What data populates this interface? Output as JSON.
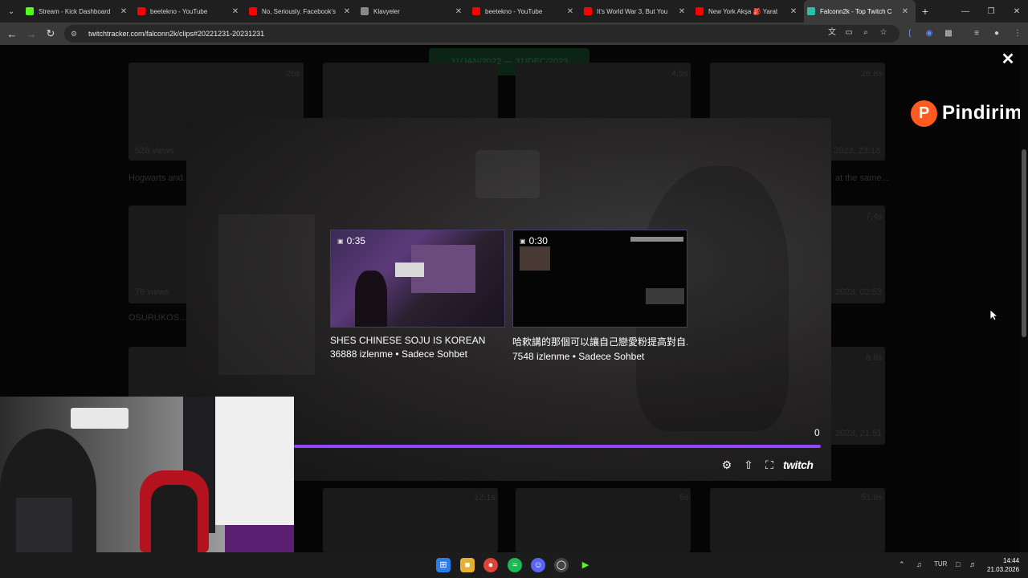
{
  "browser": {
    "tabs": [
      {
        "title": "Stream - Kick Dashboard",
        "icon": "kick-icon",
        "color": "#53fc18"
      },
      {
        "title": "beetekno - YouTube",
        "icon": "youtube-icon",
        "color": "#ff0000"
      },
      {
        "title": "No, Seriously. Facebook's",
        "icon": "youtube-icon",
        "color": "#ff0000"
      },
      {
        "title": "Klavyeler",
        "icon": "klavyeler-icon",
        "color": "#888888"
      },
      {
        "title": "beetekno - YouTube",
        "icon": "youtube-icon",
        "color": "#ff0000"
      },
      {
        "title": "It's World War 3, But You",
        "icon": "youtube-icon",
        "color": "#ff0000"
      },
      {
        "title": "New York Akşa 🎒 Yarat",
        "icon": "youtube-icon",
        "color": "#ff0000"
      },
      {
        "title": "Falconn2k - Top Twitch C",
        "icon": "twitchtracker-icon",
        "color": "#2fbfa8"
      }
    ],
    "active_tab_index": 7,
    "url": "twitchtracker.com/falconn2k/clips#20221231-20231231"
  },
  "background_page": {
    "date_range": "31/JAN/2022 — 31/DEC/2023",
    "durations": [
      "26s",
      "4.9s",
      "26.8s",
      "7.4s",
      "8.8s",
      "12.1s",
      "5s",
      "51.9s"
    ],
    "views": [
      "528 views",
      "76 views"
    ],
    "dates": [
      "2023, 23:18",
      "2023, 02:53",
      "2023, 21:51"
    ],
    "snippets": [
      "Hogwarts and...",
      "OSURUKOS...",
      "at the same..."
    ]
  },
  "overlay": {
    "close_label": "✕",
    "brand_name": "Pindirim",
    "brand_letter": "P"
  },
  "player": {
    "suggested_clips": [
      {
        "duration": "0:35",
        "title": "SHES CHINESE SOJU IS KOREAN",
        "views": "36888 izlenme",
        "category": "Sadece Sohbet"
      },
      {
        "duration": "0:30",
        "title": "哈欶講的那個可以讓自己戀愛粉提高對自...",
        "views": "7548 izlenme",
        "category": "Sadece Sohbet"
      }
    ],
    "meta_separator": " • ",
    "progress_value": "0",
    "progress_fraction": 1.0,
    "twitch_label": "twitch"
  },
  "taskbar": {
    "language": "TUR",
    "time": "14:44",
    "date": "21.03.2026"
  }
}
